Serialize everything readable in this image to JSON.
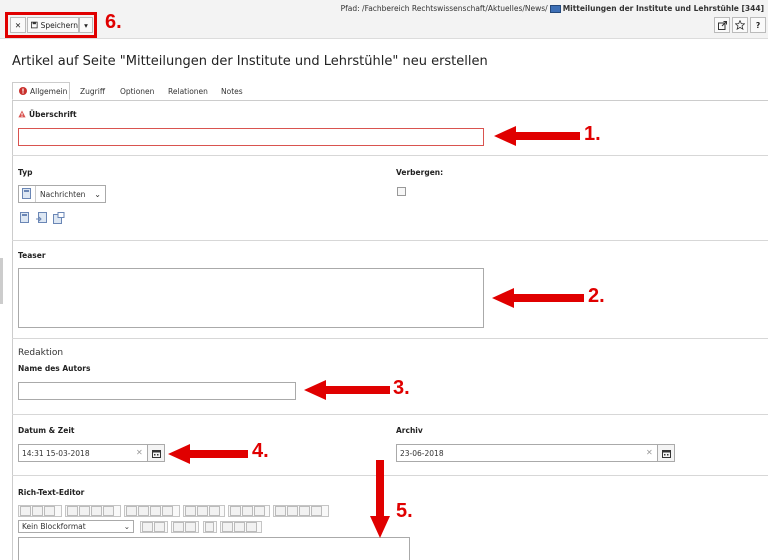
{
  "header": {
    "path_prefix": "Pfad: /Fachbereich Rechtswissenschaft/Aktuelles/News/",
    "path_page": "Mitteilungen der Institute und Lehrstühle [344]",
    "close_label": "✕",
    "save_label": "Speichern",
    "dropdown_label": "▾",
    "help_label": "?"
  },
  "annotations": {
    "a1": "1.",
    "a2": "2.",
    "a3": "3.",
    "a4": "4.",
    "a5": "5.",
    "a6": "6."
  },
  "page_title": "Artikel auf Seite \"Mitteilungen der Institute und Lehrstühle\" neu erstellen",
  "tabs": [
    {
      "label": "Allgemein"
    },
    {
      "label": "Zugriff"
    },
    {
      "label": "Optionen"
    },
    {
      "label": "Relationen"
    },
    {
      "label": "Notes"
    }
  ],
  "form": {
    "heading_label": "Überschrift",
    "heading_value": "",
    "type_label": "Typ",
    "type_value": "Nachrichten",
    "hide_label": "Verbergen:",
    "teaser_label": "Teaser",
    "teaser_value": "",
    "editorial_heading": "Redaktion",
    "author_label": "Name des Autors",
    "author_value": "",
    "datetime_label": "Datum & Zeit",
    "datetime_value": "14:31 15-03-2018",
    "archive_label": "Archiv",
    "archive_value": "23-06-2018",
    "rte_label": "Rich-Text-Editor",
    "blockformat_value": "Kein Blockformat"
  },
  "colors": {
    "annotation_red": "#e00000",
    "error_red": "#d9534f"
  }
}
